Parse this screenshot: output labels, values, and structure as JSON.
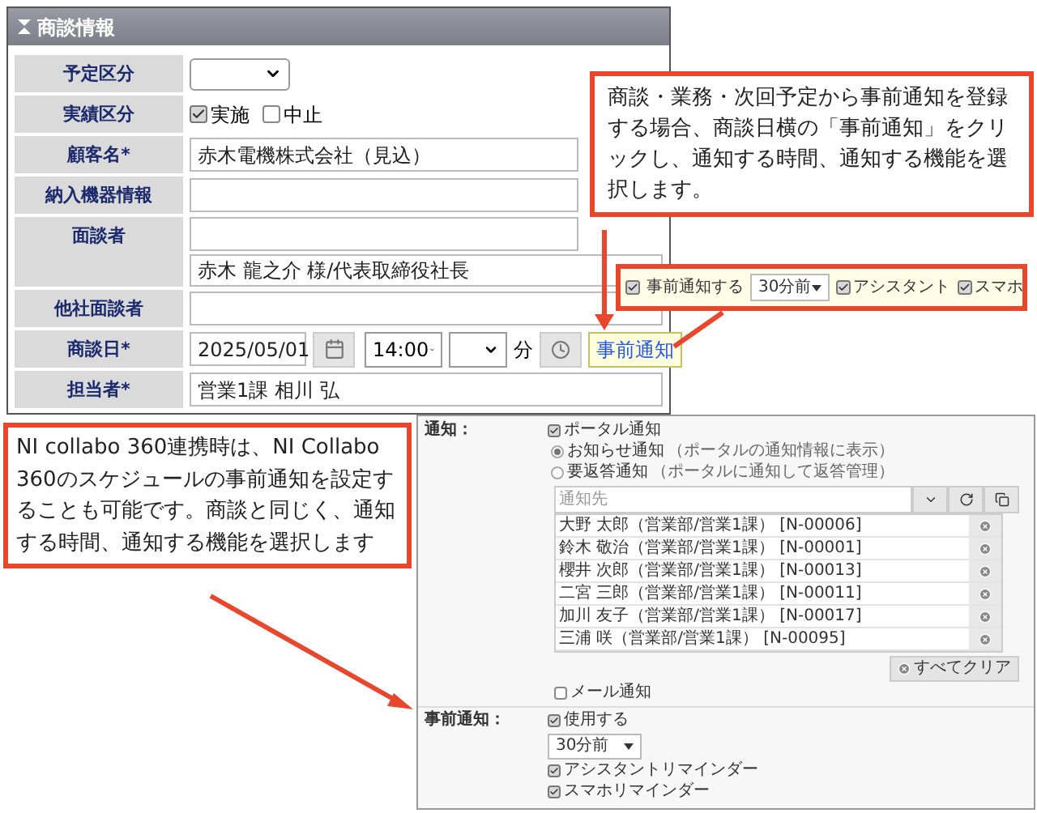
{
  "form": {
    "title": "商談情報",
    "rows": [
      {
        "kind": "select",
        "label": "予定区分"
      },
      {
        "kind": "checks",
        "label": "実績区分",
        "options": [
          {
            "label": "実施",
            "checked": true
          },
          {
            "label": "中止",
            "checked": false
          }
        ]
      },
      {
        "kind": "text",
        "label": "顧客名*",
        "value": "赤木電機株式会社（見込）"
      },
      {
        "kind": "text",
        "label": "納入機器情報"
      },
      {
        "kind": "pair",
        "label": "面談者",
        "value": "赤木 龍之介 様/代表取締役社長"
      },
      {
        "kind": "text",
        "label": "他社面談者"
      },
      {
        "kind": "date",
        "label": "商談日*",
        "date": "2025/05/01",
        "hour": "14:00",
        "unit": "分",
        "notify_button": "事前通知"
      },
      {
        "kind": "text",
        "label": "担当者*",
        "value": "営業1課 相川 弘"
      }
    ]
  },
  "popup": {
    "notify": {
      "label": "事前通知する",
      "checked": true
    },
    "timing": "30分前",
    "options": [
      {
        "label": "アシスタント",
        "checked": true
      },
      {
        "label": "スマホ",
        "checked": true
      }
    ]
  },
  "callouts": [
    "商談・業務・次回予定から事前通知を登録する場合、商談日横の「事前通知」をクリックし、通知する時間、通知する機能を選択します。",
    "NI collabo 360連携時は、NI Collabo 360のスケジュールの事前通知を設定することも可能です。商談と同じく、通知する時間、通知する機能を選択します"
  ],
  "collabo": {
    "notice_label": "通知：",
    "portal": {
      "label": "ポータル通知",
      "checked": true
    },
    "radios": [
      {
        "label": "お知らせ通知",
        "note": "（ポータルの通知情報に表示）",
        "selected": true
      },
      {
        "label": "要返答通知",
        "note": "（ポータルに通知して返答管理）",
        "selected": false
      }
    ],
    "recipient_placeholder": "通知先",
    "recipients": [
      "大野 太郎（営業部/営業1課） [N-00006]",
      "鈴木 敬治（営業部/営業1課） [N-00001]",
      "櫻井 次郎（営業部/営業1課） [N-00013]",
      "二宮 三郎（営業部/営業1課） [N-00011]",
      "加川 友子（営業部/営業1課） [N-00017]",
      "三浦 咲（営業部/営業1課） [N-00095]"
    ],
    "clear_button": "すべてクリア",
    "mail": {
      "label": "メール通知",
      "checked": false
    },
    "advance_label": "事前通知：",
    "use": {
      "label": "使用する",
      "checked": true
    },
    "timing": "30分前",
    "options": [
      {
        "label": "アシスタントリマインダー",
        "checked": true
      },
      {
        "label": "スマホリマインダー",
        "checked": true
      }
    ]
  }
}
